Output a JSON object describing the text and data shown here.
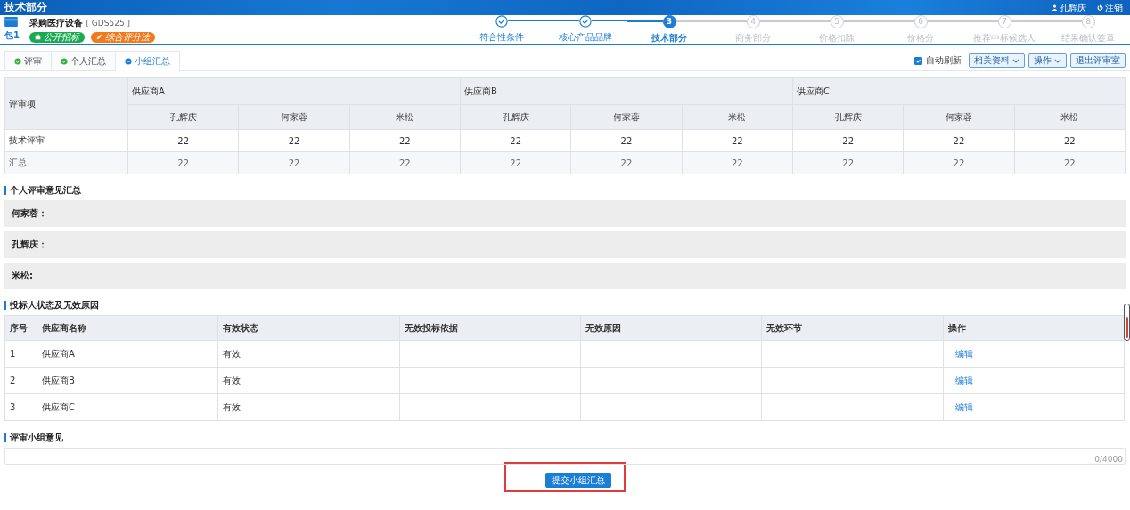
{
  "topbar": {
    "title": "技术部分",
    "user": "孔辉庆",
    "logout": "注销"
  },
  "project": {
    "package": "包1",
    "name": "采购医疗设备",
    "code": "[ GDS525 ]",
    "tags": [
      {
        "label": "公开招标",
        "color": "#1aab52"
      },
      {
        "label": "综合评分法",
        "color": "#f27a1c"
      }
    ]
  },
  "steps": [
    {
      "label": "符合性条件",
      "done": true
    },
    {
      "label": "核心产品品牌",
      "done": true
    },
    {
      "number": "3",
      "label": "技术部分",
      "done": false,
      "current": true
    },
    {
      "number": "4",
      "label": "商务部分",
      "done": false,
      "current": false
    },
    {
      "number": "5",
      "label": "价格扣除",
      "done": false,
      "current": false
    },
    {
      "number": "6",
      "label": "价格分",
      "done": false,
      "current": false
    },
    {
      "number": "7",
      "label": "推荐中标候选人",
      "done": false,
      "current": false
    },
    {
      "number": "8",
      "label": "结果确认签章",
      "done": false,
      "current": false
    }
  ],
  "tabs": [
    {
      "label": "评审",
      "selected": false,
      "done": true
    },
    {
      "label": "个人汇总",
      "selected": false,
      "done": true
    },
    {
      "label": "小组汇总",
      "selected": true,
      "done": false
    }
  ],
  "toolbar": {
    "auto_refresh": {
      "label": "自动刷新",
      "checked": true
    },
    "buttons": [
      {
        "label": "相关资料",
        "dropdown": true
      },
      {
        "label": "操作",
        "dropdown": true
      },
      {
        "label": "退出评审室",
        "dropdown": false
      }
    ]
  },
  "score_table": {
    "corner": "评审项",
    "suppliers": [
      "供应商A",
      "供应商B",
      "供应商C"
    ],
    "experts": [
      "孔辉庆",
      "何家蓉",
      "米松",
      "孔辉庆",
      "何家蓉",
      "米松",
      "孔辉庆",
      "何家蓉",
      "米松"
    ],
    "rows": [
      {
        "label": "技术评审",
        "values": [
          "22",
          "22",
          "22",
          "22",
          "22",
          "22",
          "22",
          "22",
          "22"
        ]
      },
      {
        "label": "汇总",
        "values": [
          "22",
          "22",
          "22",
          "22",
          "22",
          "22",
          "22",
          "22",
          "22"
        ]
      }
    ]
  },
  "opinions": {
    "title": "个人评审意见汇总",
    "items": [
      "何家蓉：",
      "孔辉庆：",
      "米松:"
    ]
  },
  "status_table": {
    "title": "投标人状态及无效原因",
    "columns": [
      "序号",
      "供应商名称",
      "有效状态",
      "无效投标依据",
      "无效原因",
      "无效环节",
      "操作"
    ],
    "rows": [
      {
        "index": "1",
        "supplier": "供应商A",
        "status": "有效",
        "action": "编辑"
      },
      {
        "index": "2",
        "supplier": "供应商B",
        "status": "有效",
        "action": "编辑"
      },
      {
        "index": "3",
        "supplier": "供应商C",
        "status": "有效",
        "action": "编辑"
      }
    ]
  },
  "group_opinion": {
    "title": "评审小组意见",
    "counter": "0/4000"
  },
  "submit": {
    "label": "提交小组汇总",
    "highlighted": true
  }
}
